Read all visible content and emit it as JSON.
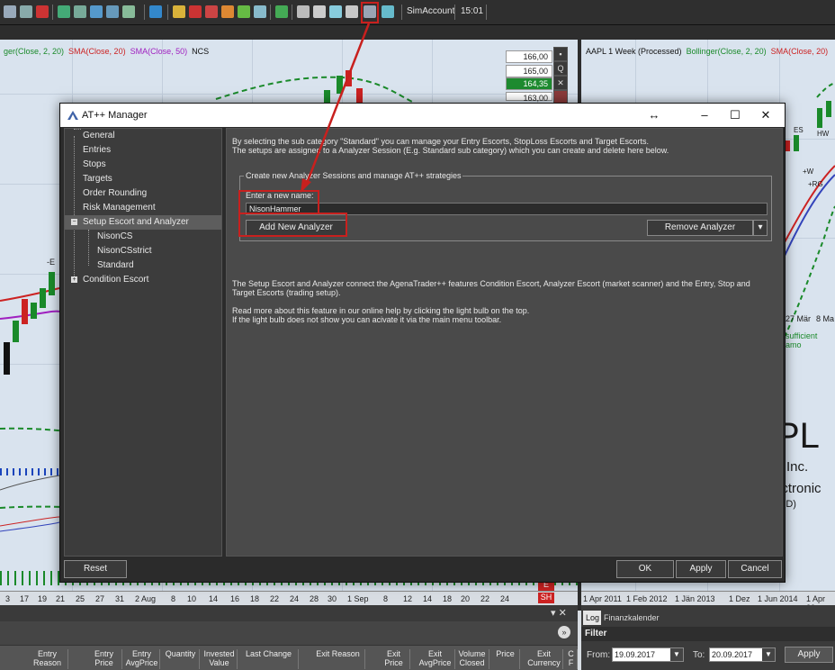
{
  "toolbar": {
    "account": "SimAccount",
    "time": "15:01"
  },
  "left_chart": {
    "legend_a": "ger(Close, 2, 20)",
    "legend_b": "SMA(Close, 20)",
    "legend_c": "SMA(Close, 50)",
    "legend_d": "NCS",
    "prices": [
      "166,00",
      "165,00",
      "164,35",
      "163,00"
    ],
    "marker_e": "-E",
    "dates": [
      "3",
      "17",
      "19",
      "21",
      "25",
      "27",
      "31",
      "2 Aug",
      "8",
      "10",
      "14",
      "16",
      "18",
      "22",
      "24",
      "28",
      "30",
      "1 Sep",
      "8",
      "12",
      "14",
      "18",
      "20",
      "22",
      "24"
    ],
    "sh_label": "SH",
    "e_label": "E"
  },
  "right_chart": {
    "legend_a": "AAPL 1 Week (Processed)",
    "legend_b": "Bollinger(Close, 2, 20)",
    "legend_c": "SMA(Close, 20)",
    "labels": [
      "ES",
      "HW",
      "+W",
      "+RG"
    ],
    "date_marks": [
      "27 Mär",
      "8 Ma"
    ],
    "warning": "sufficient amo",
    "big_letters": "PL",
    "company_inc": "Inc.",
    "company_elec": "ectronic",
    "company_sd": "SD)",
    "dates": [
      "1 Apr 2011",
      "1 Feb 2012",
      "1 Jän 2013",
      "1 Dez",
      "1 Jun 2014",
      "1 Apr 20"
    ]
  },
  "bottom": {
    "columns": [
      "Entry Reason",
      "Entry Price",
      "Entry AvgPrice",
      "Quantity",
      "Invested Value",
      "Last Change",
      "Exit Reason",
      "Exit Price",
      "Exit AvgPrice",
      "Volume Closed",
      "Price",
      "Exit Currency",
      "C F"
    ]
  },
  "bottom_right": {
    "tab_log": "Log",
    "tab_cal": "Finanzkalender",
    "filter": "Filter",
    "from_label": "From:",
    "from_value": "19.09.2017",
    "to_label": "To:",
    "to_value": "20.09.2017",
    "apply": "Apply"
  },
  "dialog": {
    "title": "AT++ Manager",
    "nav": [
      {
        "label": "General"
      },
      {
        "label": "Entries"
      },
      {
        "label": "Stops"
      },
      {
        "label": "Targets"
      },
      {
        "label": "Order Rounding"
      },
      {
        "label": "Risk Management"
      },
      {
        "label": "Setup Escort and Analyzer"
      },
      {
        "label": "NisonCS"
      },
      {
        "label": "NisonCSstrict"
      },
      {
        "label": "Standard"
      },
      {
        "label": "Condition Escort"
      }
    ],
    "intro_line1": "By selecting the sub category \"Standard\" you can manage your Entry Escorts, StopLoss Escorts and Target Escorts.",
    "intro_line2": "The setups are assigned to a Analyzer Session (E.g. Standard sub category) which you can create and delete here below.",
    "group_title": "Create new Analyzer Sessions and manage AT++ strategies",
    "field_label": "Enter a new name:",
    "field_value": "NisonHammer",
    "add_button": "Add New Analyzer",
    "remove_button": "Remove Analyzer",
    "desc_line1": "The Setup Escort and Analyzer connect the AgenaTrader++ features Condition Escort, Analyzer Escort (market scanner) and the Entry, Stop and",
    "desc_line2": "Target Escorts (trading setup).",
    "help_line1": "Read more about this feature in our online help by clicking the light bulb on the top.",
    "help_line2": "If the light bulb does not show you can acivate it via the main menu toolbar.",
    "reset_button": "Reset",
    "ok_button": "OK",
    "apply_button": "Apply",
    "cancel_button": "Cancel"
  },
  "colors": {
    "highlight": "#c8201e",
    "bollinger": "#1a8a2a",
    "sma20": "#cc2222",
    "sma50": "#a020c0"
  }
}
